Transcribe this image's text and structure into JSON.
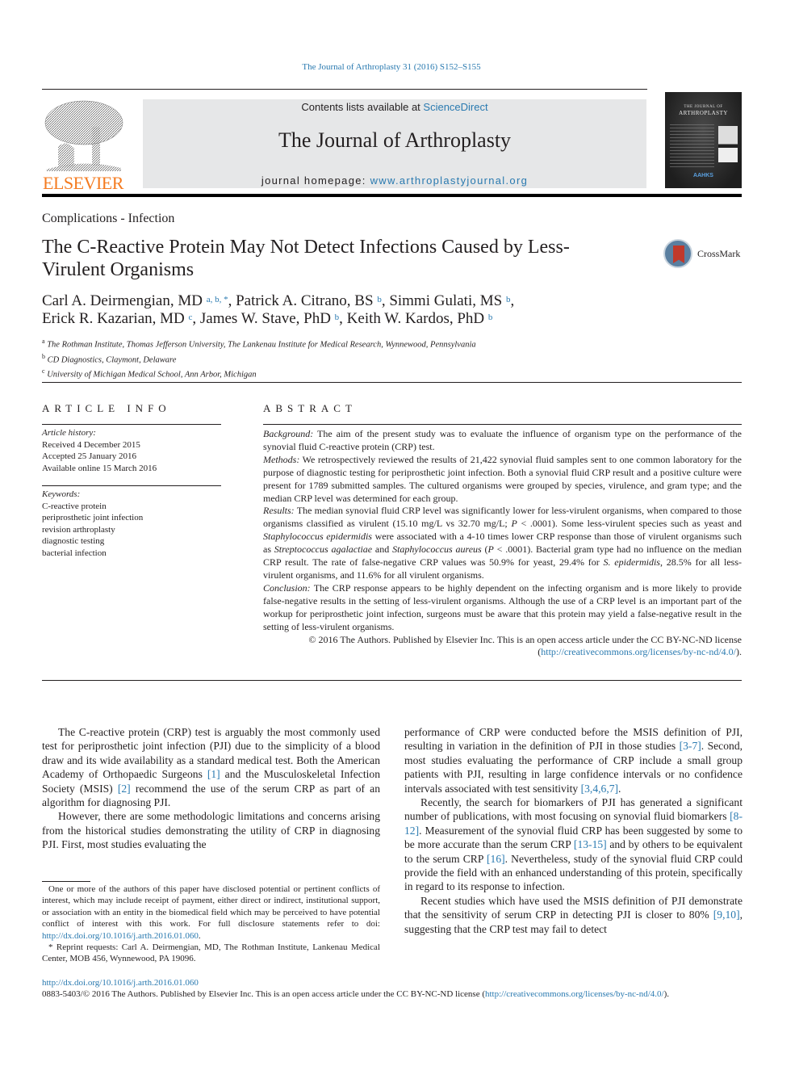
{
  "running_head": "The Journal of Arthroplasty 31 (2016) S152–S155",
  "masthead": {
    "publisher_logo": "ELSEVIER",
    "contents_prefix": "Contents lists available at ",
    "contents_link": "ScienceDirect",
    "journal_title": "The Journal of Arthroplasty",
    "homepage_prefix": "journal homepage: ",
    "homepage_link": "www.arthroplastyjournal.org",
    "cover_line1": "THE JOURNAL OF",
    "cover_line2": "ARTHROPLASTY",
    "cover_society": "AAHKS"
  },
  "article": {
    "section": "Complications - Infection",
    "title": "The C-Reactive Protein May Not Detect Infections Caused by Less-Virulent Organisms",
    "crossmark": "CrossMark",
    "authors": [
      {
        "name": "Carl A. Deirmengian, MD",
        "aff": "a, b, *"
      },
      {
        "name": "Patrick A. Citrano, BS",
        "aff": "b"
      },
      {
        "name": "Simmi Gulati, MS",
        "aff": "b"
      },
      {
        "name": "Erick R. Kazarian, MD",
        "aff": "c"
      },
      {
        "name": "James W. Stave, PhD",
        "aff": "b"
      },
      {
        "name": "Keith W. Kardos, PhD",
        "aff": "b"
      }
    ],
    "affiliations": [
      {
        "key": "a",
        "text": "The Rothman Institute, Thomas Jefferson University, The Lankenau Institute for Medical Research, Wynnewood, Pennsylvania"
      },
      {
        "key": "b",
        "text": "CD Diagnostics, Claymont, Delaware"
      },
      {
        "key": "c",
        "text": "University of Michigan Medical School, Ann Arbor, Michigan"
      }
    ]
  },
  "article_info": {
    "heading": "ARTICLE INFO",
    "history_label": "Article history:",
    "history": [
      "Received 4 December 2015",
      "Accepted 25 January 2016",
      "Available online 15 March 2016"
    ],
    "keywords_label": "Keywords:",
    "keywords": [
      "C-reactive protein",
      "periprosthetic joint infection",
      "revision arthroplasty",
      "diagnostic testing",
      "bacterial infection"
    ]
  },
  "abstract": {
    "heading": "ABSTRACT",
    "background_label": "Background:",
    "background": "The aim of the present study was to evaluate the influence of organism type on the performance of the synovial fluid C-reactive protein (CRP) test.",
    "methods_label": "Methods:",
    "methods": "We retrospectively reviewed the results of 21,422 synovial fluid samples sent to one common laboratory for the purpose of diagnostic testing for periprosthetic joint infection. Both a synovial fluid CRP result and a positive culture were present for 1789 submitted samples. The cultured organisms were grouped by species, virulence, and gram type; and the median CRP level was determined for each group.",
    "results_label": "Results:",
    "results_p1": "The median synovial fluid CRP level was significantly lower for less-virulent organisms, when compared to those organisms classified as virulent (15.10 mg/L vs 32.70 mg/L; ",
    "results_p_italic": "P",
    "results_p2": " < .0001). Some less-virulent species such as yeast and ",
    "results_sepi": "Staphylococcus epidermidis",
    "results_p3": " were associated with a 4-10 times lower CRP response than those of virulent organisms such as ",
    "results_sag": "Streptococcus agalactiae",
    "results_and": " and ",
    "results_sau": "Staphylococcus aureus",
    "results_p4_open": " (",
    "results_p4": " < .0001). Bacterial gram type had no influence on the median CRP result. The rate of false-negative CRP values was 50.9% for yeast, 29.4% for ",
    "results_sepi_short": "S. epidermidis",
    "results_p5": ", 28.5% for all less-virulent organisms, and 11.6% for all virulent organisms.",
    "conclusion_label": "Conclusion:",
    "conclusion": "The CRP response appears to be highly dependent on the infecting organism and is more likely to provide false-negative results in the setting of less-virulent organisms. Although the use of a CRP level is an important part of the workup for periprosthetic joint infection, surgeons must be aware that this protein may yield a false-negative result in the setting of less-virulent organisms.",
    "copyright_text": "© 2016 The Authors. Published by Elsevier Inc. This is an open access article under the CC BY-NC-ND license (",
    "copyright_link": "http://creativecommons.org/licenses/by-nc-nd/4.0/",
    "copyright_close": ")."
  },
  "body": {
    "left_p1_a": "The C-reactive protein (CRP) test is arguably the most commonly used test for periprosthetic joint infection (PJI) due to the simplicity of a blood draw and its wide availability as a standard medical test. Both the American Academy of Orthopaedic Surgeons ",
    "ref1": "[1]",
    "left_p1_b": " and the Musculoskeletal Infection Society (MSIS) ",
    "ref2": "[2]",
    "left_p1_c": " recommend the use of the serum CRP as part of an algorithm for diagnosing PJI.",
    "left_p2": "However, there are some methodologic limitations and concerns arising from the historical studies demonstrating the utility of CRP in diagnosing PJI. First, most studies evaluating the",
    "right_p1_a": "performance of CRP were conducted before the MSIS definition of PJI, resulting in variation in the definition of PJI in those studies ",
    "ref3_7": "[3-7]",
    "right_p1_b": ". Second, most studies evaluating the performance of CRP include a small group patients with PJI, resulting in large confidence intervals or no confidence intervals associated with test sensitivity ",
    "ref3467": "[3,4,6,7]",
    "right_p1_c": ".",
    "right_p2_a": "Recently, the search for biomarkers of PJI has generated a significant number of publications, with most focusing on synovial fluid biomarkers ",
    "ref8_12": "[8-12]",
    "right_p2_b": ". Measurement of the synovial fluid CRP has been suggested by some to be more accurate than the serum CRP ",
    "ref13_15": "[13-15]",
    "right_p2_c": " and by others to be equivalent to the serum CRP ",
    "ref16": "[16]",
    "right_p2_d": ". Nevertheless, study of the synovial fluid CRP could provide the field with an enhanced understanding of this protein, specifically in regard to its response to infection.",
    "right_p3_a": "Recent studies which have used the MSIS definition of PJI demonstrate that the sensitivity of serum CRP in detecting PJI is closer to 80% ",
    "ref9_10": "[9,10]",
    "right_p3_b": ", suggesting that the CRP test may fail to detect"
  },
  "footnotes": {
    "coi_text": "One or more of the authors of this paper have disclosed potential or pertinent conflicts of interest, which may include receipt of payment, either direct or indirect, institutional support, or association with an entity in the biomedical field which may be perceived to have potential conflict of interest with this work. For full disclosure statements refer to doi: ",
    "coi_link": "http://dx.doi.org/10.1016/j.arth.2016.01.060",
    "coi_end": ".",
    "reprint": "* Reprint requests: Carl A. Deirmengian, MD, The Rothman Institute, Lankenau Medical Center, MOB 456, Wynnewood, PA 19096."
  },
  "page_footer": {
    "doi": "http://dx.doi.org/10.1016/j.arth.2016.01.060",
    "license_text": "0883-5403/© 2016 The Authors. Published by Elsevier Inc. This is an open access article under the CC BY-NC-ND license (",
    "license_link": "http://creativecommons.org/licenses/by-nc-nd/4.0/",
    "license_close": ")."
  },
  "colors": {
    "link": "#2a7ab0",
    "elsevier_orange": "#f47b20",
    "masthead_bg": "#e6e7e8"
  }
}
